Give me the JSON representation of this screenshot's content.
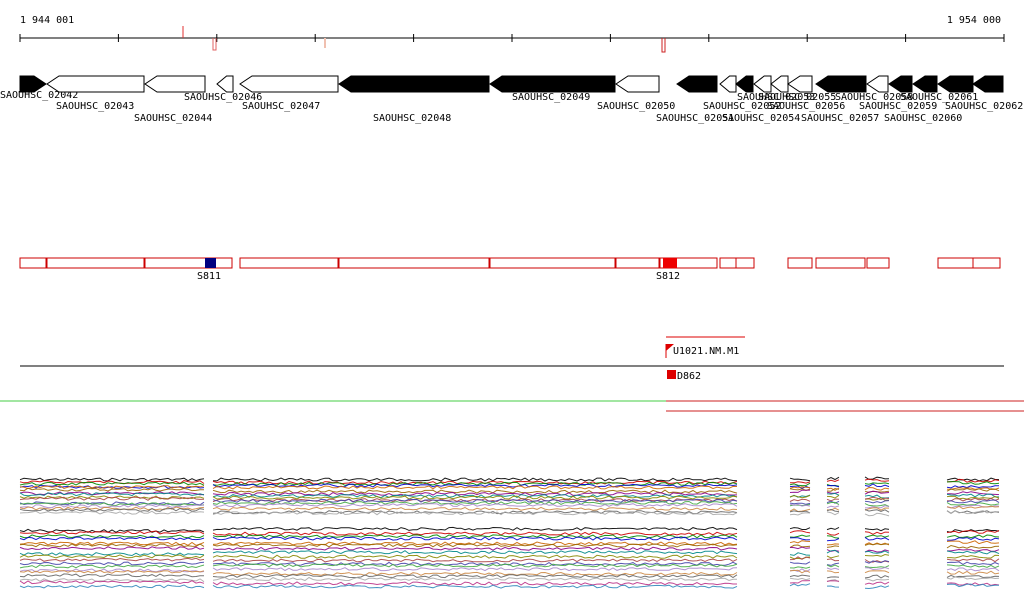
{
  "coordinates": {
    "start": "1 944 001",
    "end": "1 954 000"
  },
  "genes": [
    {
      "id": "SAOUHSC_02042",
      "strand": "+",
      "filled": true
    },
    {
      "id": "SAOUHSC_02043",
      "strand": "-",
      "filled": false
    },
    {
      "id": "SAOUHSC_02044",
      "strand": "-",
      "filled": false
    },
    {
      "id": "SAOUHSC_02046",
      "strand": "-",
      "filled": false
    },
    {
      "id": "SAOUHSC_02047",
      "strand": "-",
      "filled": false
    },
    {
      "id": "SAOUHSC_02048",
      "strand": "-",
      "filled": true
    },
    {
      "id": "SAOUHSC_02049",
      "strand": "-",
      "filled": true
    },
    {
      "id": "SAOUHSC_02050",
      "strand": "-",
      "filled": false
    },
    {
      "id": "SAOUHSC_02051",
      "strand": "-",
      "filled": true
    },
    {
      "id": "SAOUHSC_02052",
      "strand": "-",
      "filled": false
    },
    {
      "id": "SAOUHSC_02053",
      "strand": "-",
      "filled": true
    },
    {
      "id": "SAOUHSC_02054",
      "strand": "-",
      "filled": false
    },
    {
      "id": "SAOUHSC_02055",
      "strand": "-",
      "filled": false
    },
    {
      "id": "SAOUHSC_02056",
      "strand": "-",
      "filled": false
    },
    {
      "id": "SAOUHSC_02057",
      "strand": "-",
      "filled": true
    },
    {
      "id": "SAOUHSC_02058",
      "strand": "-",
      "filled": false
    },
    {
      "id": "SAOUHSC_02059",
      "strand": "-",
      "filled": true
    },
    {
      "id": "SAOUHSC_02060",
      "strand": "-",
      "filled": true
    },
    {
      "id": "SAOUHSC_02061",
      "strand": "-",
      "filled": true
    },
    {
      "id": "SAOUHSC_02062",
      "strand": "-",
      "filled": true
    }
  ],
  "segments": [
    {
      "name": "S811",
      "color": "#000080"
    },
    {
      "name": "S812",
      "color": "#ee0000"
    }
  ],
  "features": {
    "transcript": "U1021.NM.M1",
    "promoter": "D862"
  },
  "colors": {
    "gene_outline": "#000000",
    "segment_outline": "#cc0000",
    "feature_red": "#dd0000",
    "track_green": "#44cc44"
  }
}
